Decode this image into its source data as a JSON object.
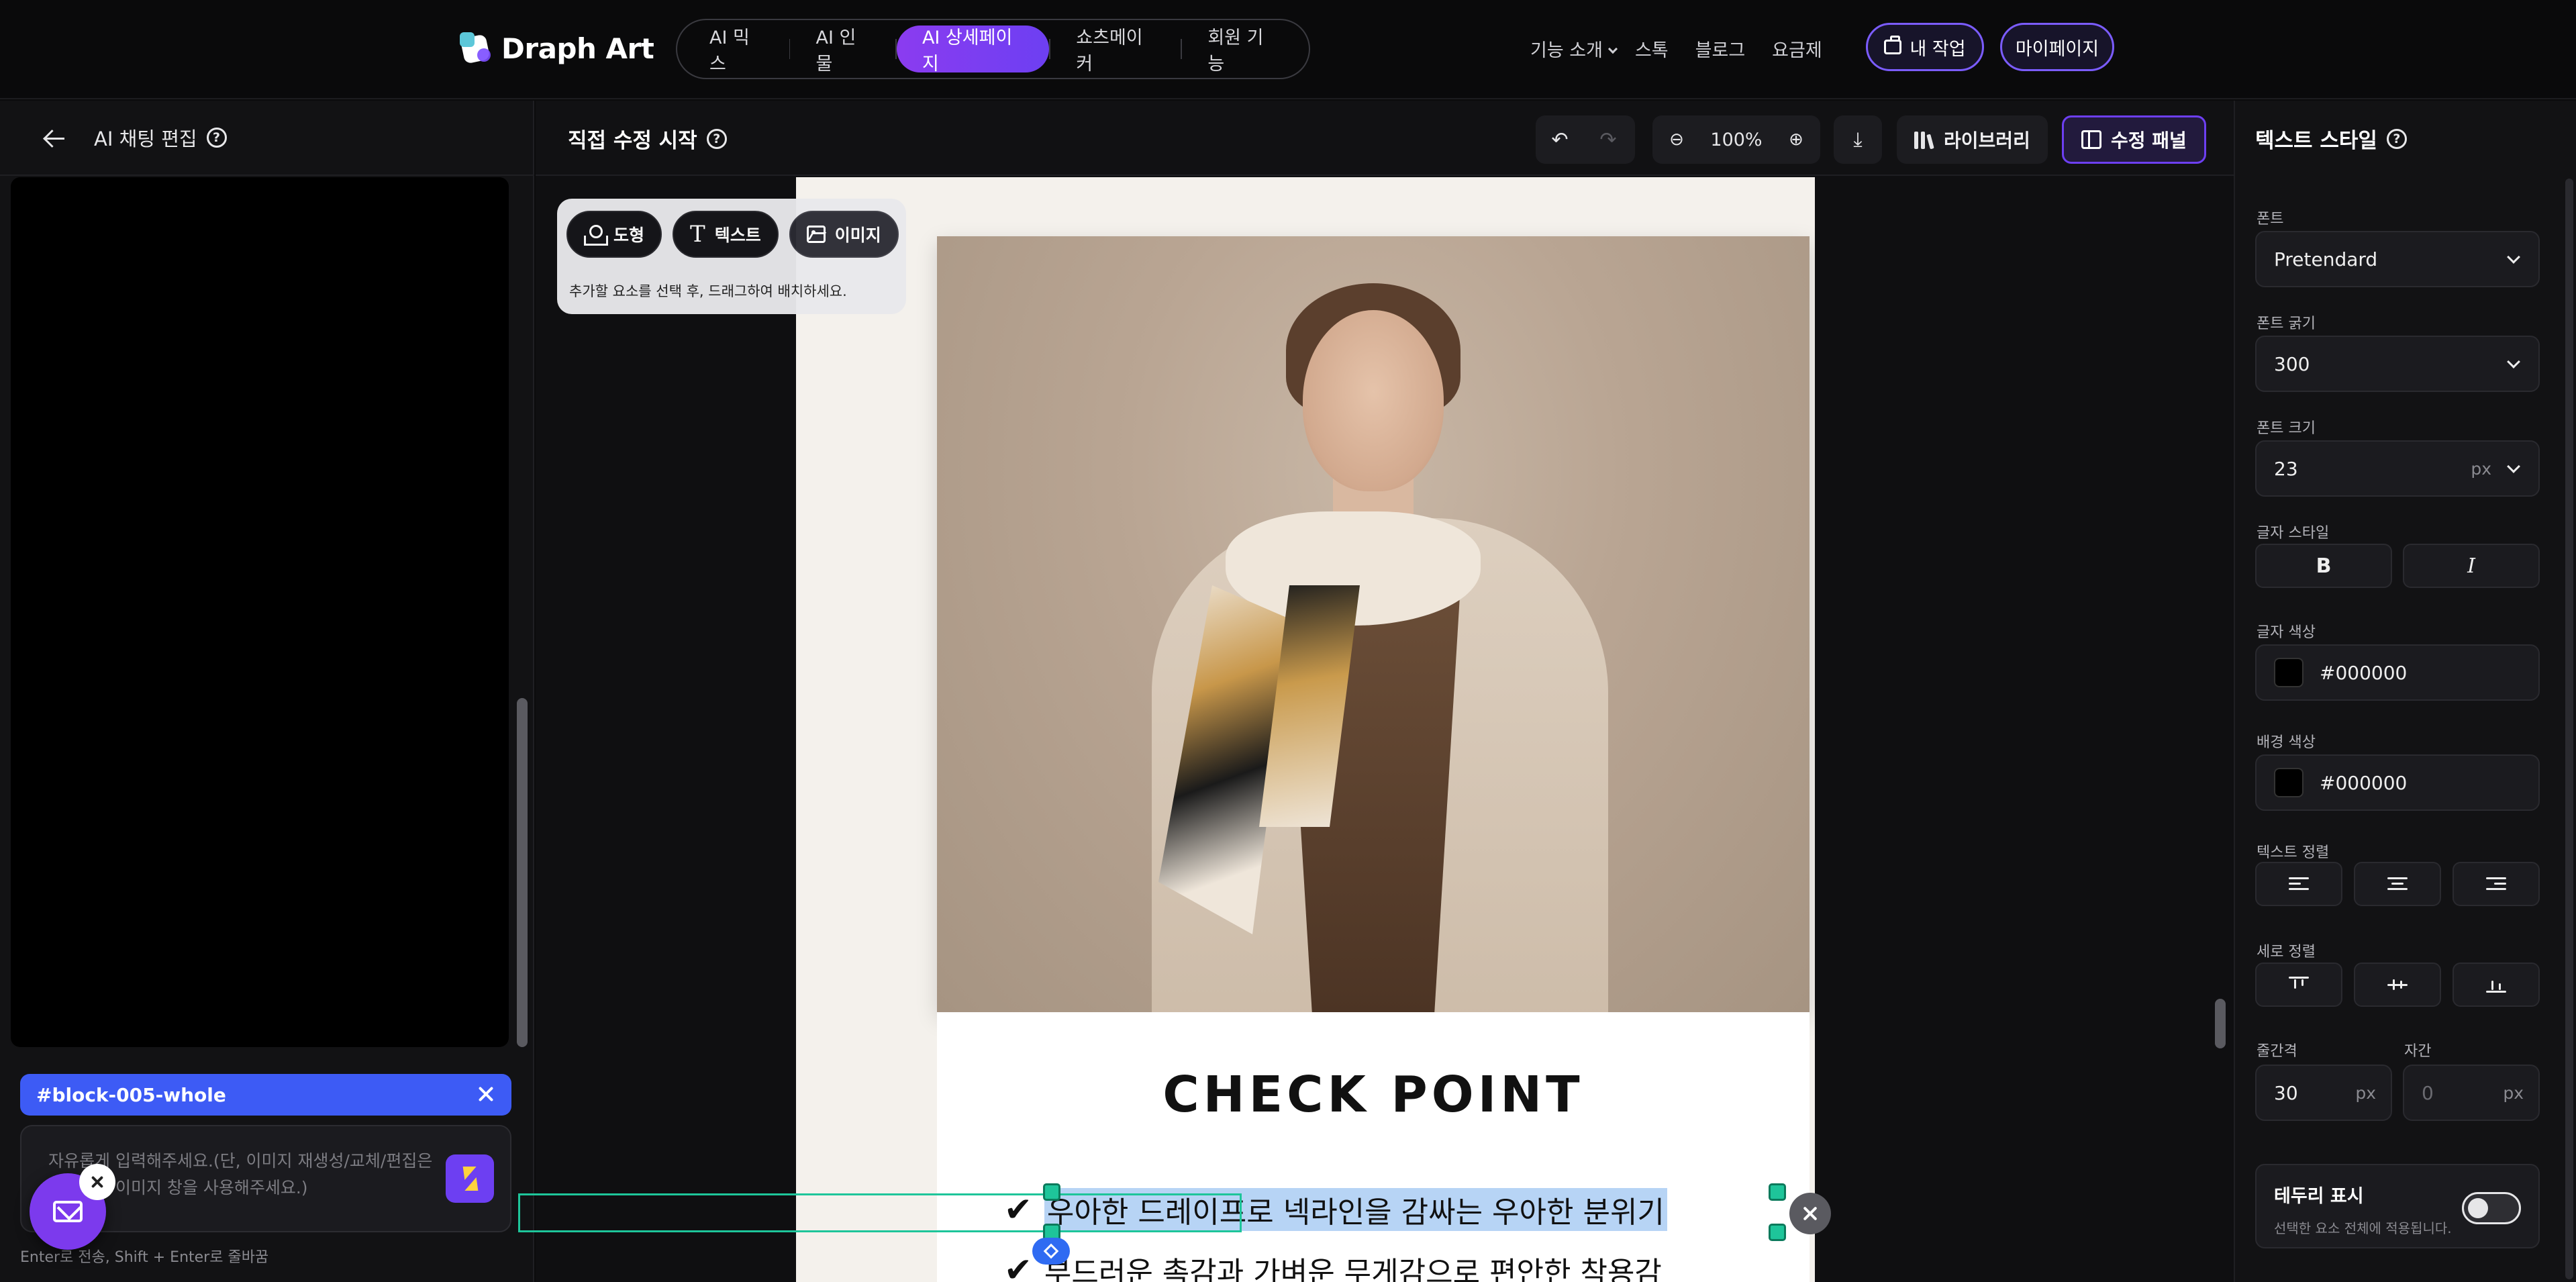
{
  "brand": {
    "name": "Draph Art"
  },
  "nav": {
    "items": [
      {
        "label": "AI 믹스"
      },
      {
        "label": "AI 인물"
      },
      {
        "label": "AI 상세페이지"
      },
      {
        "label": "쇼츠메이커"
      },
      {
        "label": "회원 기능"
      }
    ],
    "right": {
      "feature": "기능 소개",
      "stock": "스톡",
      "blog": "블로그",
      "pricing": "요금제"
    },
    "my_work": "내 작업",
    "my_page": "마이페이지"
  },
  "left_panel": {
    "title": "AI 채팅 편집",
    "tag": "#block-005-whole",
    "input_placeholder": "자유롭게 입력해주세요.(단, 이미지 재생성/교체/편집은 오른쪽의 이미지 창을 사용해주세요.)",
    "hint": "Enter로 전송, Shift + Enter로 줄바꿈"
  },
  "editor": {
    "title": "직접 수정 시작",
    "zoom": "100%",
    "library": "라이브러리",
    "edit_panel": "수정 패널",
    "add_popover": {
      "shape": "도형",
      "text": "텍스트",
      "image": "이미지",
      "note": "추가할 요소를 선택 후, 드래그하여 배치하세요."
    },
    "canvas": {
      "heading": "CHECK POINT",
      "check_mark": "✔",
      "line1": "우아한 드레이프로 넥라인을 감싸는 우아한 분위기",
      "line2": "부드러운 촉감과 가벼운 무게감으로 편안한 착용감"
    }
  },
  "right_panel": {
    "title": "텍스트 스타일",
    "font_label": "폰트",
    "font_value": "Pretendard",
    "weight_label": "폰트 굵기",
    "weight_value": "300",
    "size_label": "폰트 크기",
    "size_value": "23",
    "size_unit": "px",
    "style_label": "글자 스타일",
    "bold": "B",
    "italic": "I",
    "color_label": "글자 색상",
    "color_value": "#000000",
    "bg_label": "배경 색상",
    "bg_value": "#000000",
    "align_label": "텍스트 정렬",
    "valign_label": "세로 정렬",
    "line_height_label": "줄간격",
    "line_height_value": "30",
    "line_height_unit": "px",
    "letter_spacing_label": "자간",
    "letter_spacing_placeholder": "0",
    "letter_spacing_unit": "px",
    "border_title": "테두리 표시",
    "border_desc": "선택한 요소 전체에 적용됩니다."
  },
  "colors": {
    "accent": "#7c3aed",
    "tag_blue": "#3d5bf5",
    "selection": "#1ec59a"
  }
}
